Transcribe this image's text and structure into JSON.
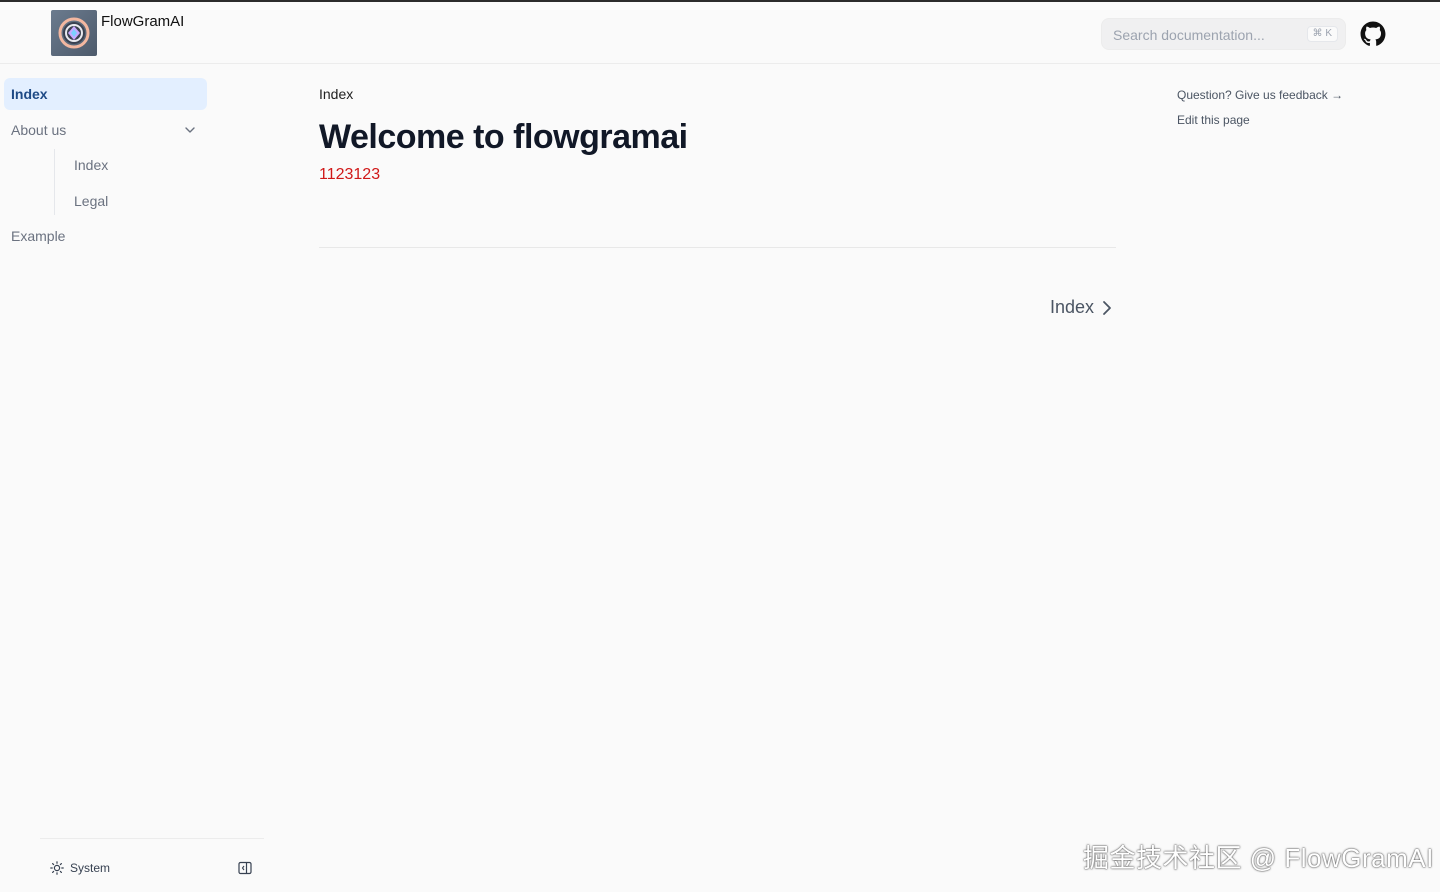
{
  "header": {
    "brand": "FlowGramAI",
    "search_placeholder": "Search documentation...",
    "search_shortcut": "⌘ K"
  },
  "sidebar": {
    "items": [
      {
        "label": "Index",
        "active": true
      },
      {
        "label": "About us",
        "expanded": true,
        "children": [
          {
            "label": "Index"
          },
          {
            "label": "Legal"
          }
        ]
      },
      {
        "label": "Example"
      }
    ],
    "theme_label": "System"
  },
  "main": {
    "breadcrumb": "Index",
    "title": "Welcome to flowgramai",
    "red_text": "1123123",
    "next_label": "Index"
  },
  "toc": {
    "feedback": "Question? Give us feedback →",
    "edit": "Edit this page"
  },
  "watermark": "掘金技术社区 @ FlowGramAI",
  "colors": {
    "active_bg": "#e3efff",
    "active_text": "#1e4a86",
    "red": "#d01818"
  }
}
